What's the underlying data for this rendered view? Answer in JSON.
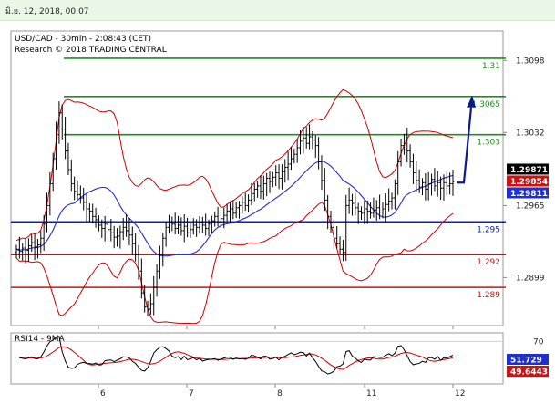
{
  "header": {
    "datetime": "มิ.ย. 12, 2018, 00:07"
  },
  "colors": {
    "background": "#ffffff",
    "header_bg": "#eaf7e6",
    "candles": "#000000",
    "bollinger": "#cc0000",
    "moving_average": "#1f2fd0",
    "resistance": "#228b22",
    "support_blue": "#0a1fb8",
    "support_red": "#c81414",
    "arrow": "#0b1a8c",
    "price_badge": "#000000",
    "ma_badge": "#1f2fd0",
    "band_badge": "#c81414",
    "rsi_line": "#000000",
    "rsi_ma": "#cc0000"
  },
  "chart_data": [
    {
      "type": "candlestick",
      "title": "USD/CAD - 30min - 2:08:43 (CET)",
      "subtitle": "Research © 2018 TRADING CENTRAL",
      "x_ticks": [
        "6",
        "7",
        "8",
        "11",
        "12"
      ],
      "y_ticks": [
        1.3098,
        1.3032,
        1.2965,
        1.2899
      ],
      "ylim": [
        1.2855,
        1.3125
      ],
      "levels": [
        {
          "label": "1.31",
          "value": 1.31,
          "role": "resistance"
        },
        {
          "label": "1.3065",
          "value": 1.3065,
          "role": "resistance"
        },
        {
          "label": "1.303",
          "value": 1.303,
          "role": "resistance"
        },
        {
          "label": "1.295",
          "value": 1.295,
          "role": "support-blue"
        },
        {
          "label": "1.292",
          "value": 1.292,
          "role": "support-red"
        },
        {
          "label": "1.289",
          "value": 1.289,
          "role": "support-red"
        }
      ],
      "price_labels": [
        {
          "label": "1.29871",
          "value": 1.29871,
          "role": "price"
        },
        {
          "label": "1.29854",
          "value": 1.29854,
          "role": "band"
        },
        {
          "label": "1.29811",
          "value": 1.29811,
          "role": "ma"
        }
      ],
      "close_series": [
        1.2925,
        1.2923,
        1.2926,
        1.2924,
        1.2928,
        1.2931,
        1.2927,
        1.2929,
        1.2935,
        1.2948,
        1.2965,
        1.2985,
        1.3008,
        1.303,
        1.305,
        1.3035,
        1.3015,
        1.2998,
        1.2985,
        1.2978,
        1.2975,
        1.2972,
        1.2968,
        1.2962,
        1.296,
        1.2955,
        1.2952,
        1.2947,
        1.2944,
        1.2948,
        1.2943,
        1.294,
        1.2936,
        1.2937,
        1.2941,
        1.2945,
        1.2942,
        1.2938,
        1.293,
        1.292,
        1.2905,
        1.2885,
        1.2872,
        1.287,
        1.2875,
        1.289,
        1.2905,
        1.292,
        1.2935,
        1.2945,
        1.295,
        1.2948,
        1.2944,
        1.2947,
        1.2942,
        1.2946,
        1.294,
        1.2943,
        1.2947,
        1.2945,
        1.295,
        1.2947,
        1.2944,
        1.2948,
        1.2951,
        1.2955,
        1.295,
        1.2953,
        1.2956,
        1.296,
        1.2962,
        1.2958,
        1.2963,
        1.2965,
        1.2968,
        1.2965,
        1.297,
        1.2976,
        1.298,
        1.2983,
        1.2978,
        1.2985,
        1.299,
        1.2987,
        1.2991,
        1.2995,
        1.299,
        1.2996,
        1.3,
        1.3003,
        1.3008,
        1.3012,
        1.3018,
        1.3024,
        1.3027,
        1.3022,
        1.3028,
        1.3025,
        1.302,
        1.3005,
        1.2988,
        1.297,
        1.2955,
        1.2945,
        1.2935,
        1.293,
        1.2925,
        1.2922,
        1.2965,
        1.297,
        1.2967,
        1.2963,
        1.296,
        1.2958,
        1.2962,
        1.296,
        1.2958,
        1.2961,
        1.2963,
        1.2959,
        1.2962,
        1.2966,
        1.2969,
        1.2972,
        1.2985,
        1.3005,
        1.302,
        1.3025,
        1.3015,
        1.3005,
        1.2995,
        1.2988,
        1.2982,
        1.2986,
        1.298,
        1.2985,
        1.2989,
        1.2983,
        1.2986,
        1.2981,
        1.2986,
        1.2983,
        1.2985,
        1.2987
      ],
      "forecast_arrow": {
        "from": 1.2986,
        "to": 1.3065
      }
    },
    {
      "type": "line",
      "title": "RSI14 - 9MA",
      "x_ticks": [
        "6",
        "7",
        "8",
        "11",
        "12"
      ],
      "y_ticks": [
        70
      ],
      "ylim": [
        20,
        80
      ],
      "latest_values": [
        {
          "label": "51.729",
          "value": 51.729,
          "role": "rsi"
        },
        {
          "label": "49.6443",
          "value": 49.6443,
          "role": "ma"
        }
      ]
    }
  ]
}
